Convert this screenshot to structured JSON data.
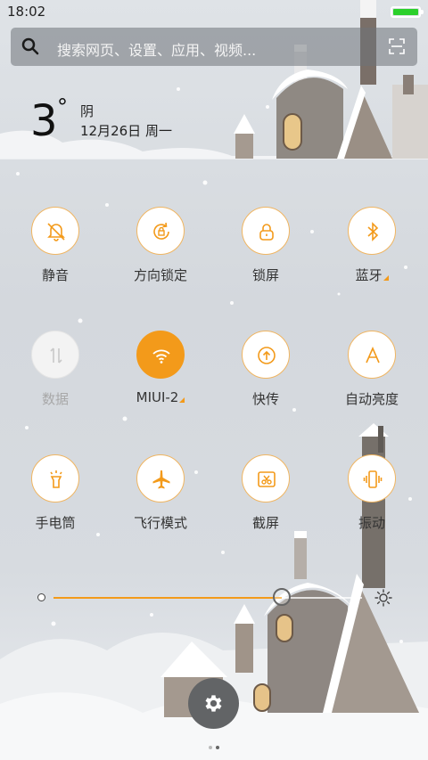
{
  "status_bar": {
    "time": "18:02",
    "battery_level": 1.0,
    "battery_color": "#2bd02b"
  },
  "search": {
    "placeholder": "搜索网页、设置、应用、视频..."
  },
  "weather": {
    "temperature": "3",
    "degree": "°",
    "condition": "阴",
    "date": "12月26日 周一"
  },
  "toggles": [
    {
      "label": "静音",
      "icon": "bell-off-icon",
      "state": "off"
    },
    {
      "label": "方向锁定",
      "icon": "rotation-lock-icon",
      "state": "off"
    },
    {
      "label": "锁屏",
      "icon": "lock-icon",
      "state": "off"
    },
    {
      "label": "蓝牙",
      "icon": "bluetooth-icon",
      "state": "off",
      "has_more": true
    },
    {
      "label": "数据",
      "icon": "mobile-data-icon",
      "state": "disabled"
    },
    {
      "label": "MIUI-2",
      "icon": "wifi-icon",
      "state": "on",
      "has_more": true
    },
    {
      "label": "快传",
      "icon": "share-upload-icon",
      "state": "off"
    },
    {
      "label": "自动亮度",
      "icon": "auto-brightness-icon",
      "state": "off"
    },
    {
      "label": "手电筒",
      "icon": "flashlight-icon",
      "state": "off"
    },
    {
      "label": "飞行模式",
      "icon": "airplane-icon",
      "state": "off"
    },
    {
      "label": "截屏",
      "icon": "screenshot-icon",
      "state": "off"
    },
    {
      "label": "振动",
      "icon": "vibrate-icon",
      "state": "off"
    }
  ],
  "brightness": {
    "level": 0.74
  },
  "pager": {
    "pages": 2,
    "current": 2
  },
  "colors": {
    "accent": "#f39a1a",
    "tile_border": "#f0b561"
  }
}
